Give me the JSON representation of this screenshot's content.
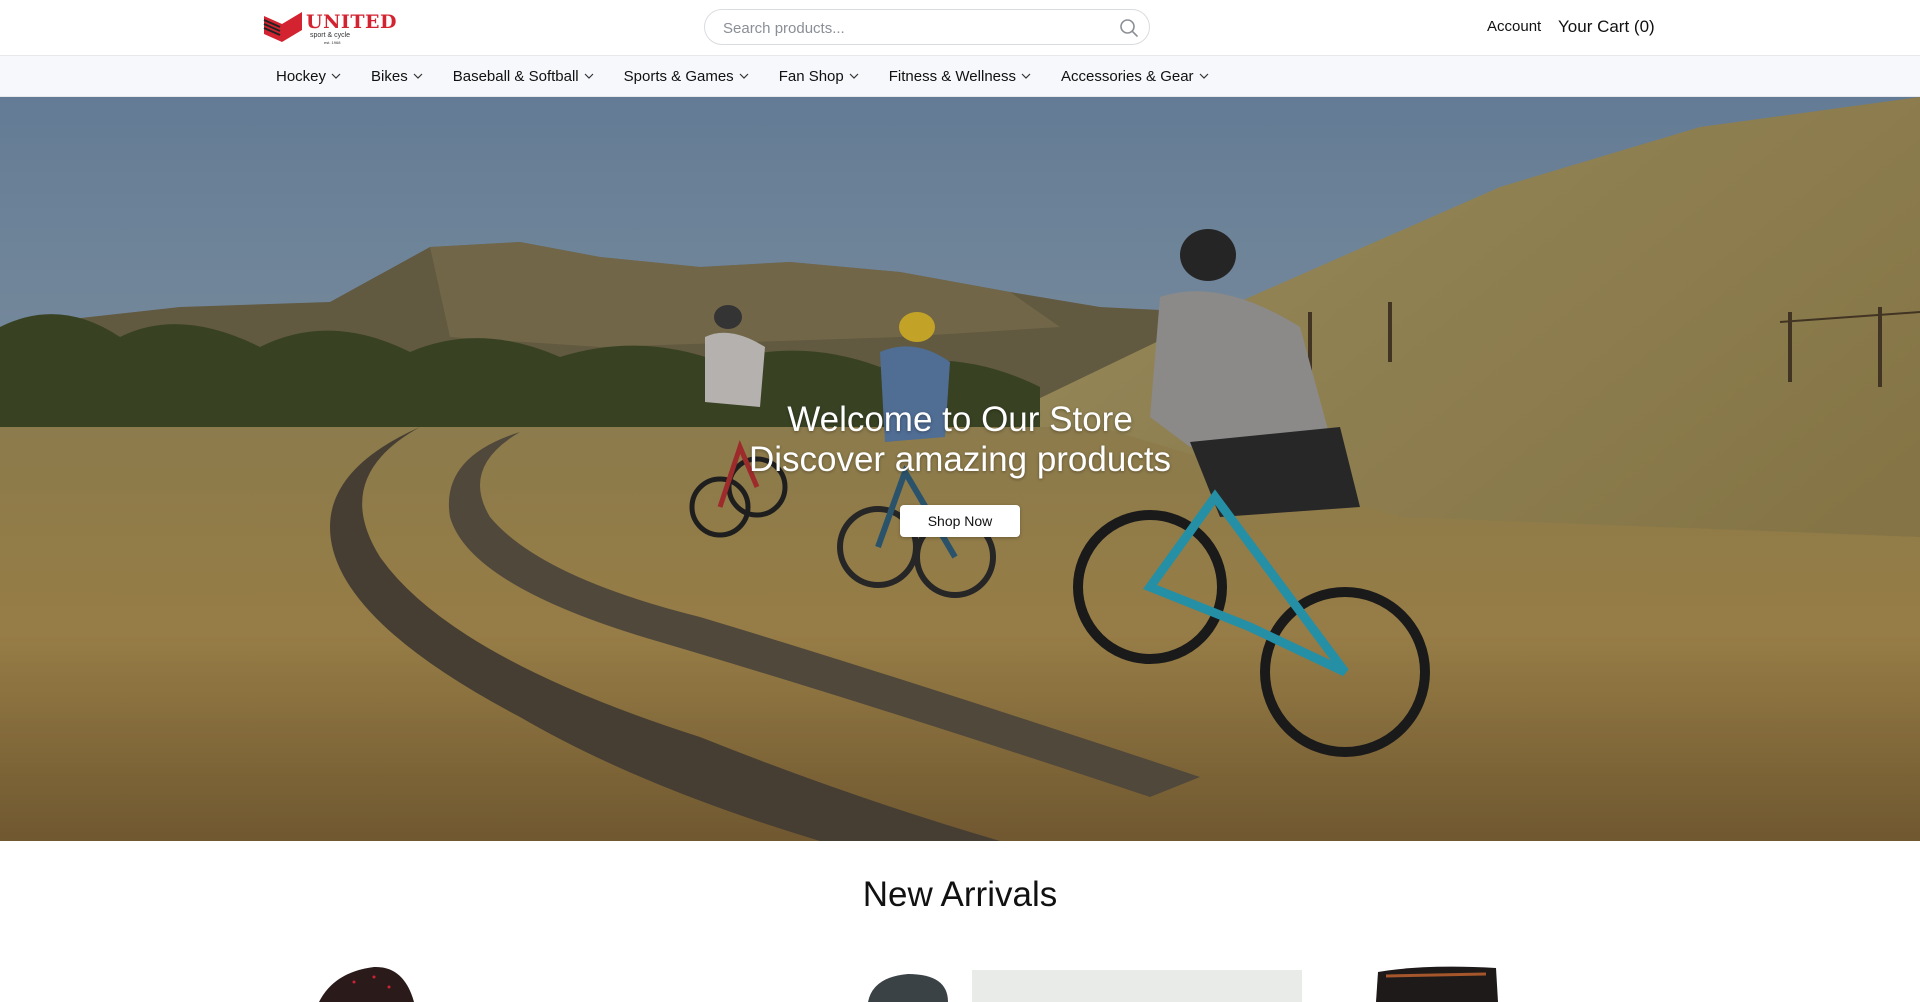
{
  "header": {
    "logo": {
      "name": "UNITED",
      "tagline": "sport & cycle",
      "est": "est. 1968"
    },
    "search": {
      "placeholder": "Search products..."
    },
    "account_label": "Account",
    "cart_label": "Your Cart (0)"
  },
  "nav": {
    "items": [
      {
        "label": "Hockey"
      },
      {
        "label": "Bikes"
      },
      {
        "label": "Baseball & Softball"
      },
      {
        "label": "Sports & Games"
      },
      {
        "label": "Fan Shop"
      },
      {
        "label": "Fitness & Wellness"
      },
      {
        "label": "Accessories & Gear"
      }
    ]
  },
  "hero": {
    "title_line1": "Welcome to Our Store",
    "title_line2": "Discover amazing products",
    "cta_label": "Shop Now",
    "image_subject": "three mountain bikers riding a dirt trail through golden grassland hills"
  },
  "new_arrivals": {
    "title": "New Arrivals",
    "products": [
      {
        "image": "dark speckled shoe"
      },
      {
        "image": "bike helmet"
      },
      {
        "image": "light product photo"
      },
      {
        "image": "dark apparel"
      }
    ]
  },
  "colors": {
    "brand_red": "#d32330",
    "nav_bg": "#f6f8fb",
    "text": "#111111"
  }
}
